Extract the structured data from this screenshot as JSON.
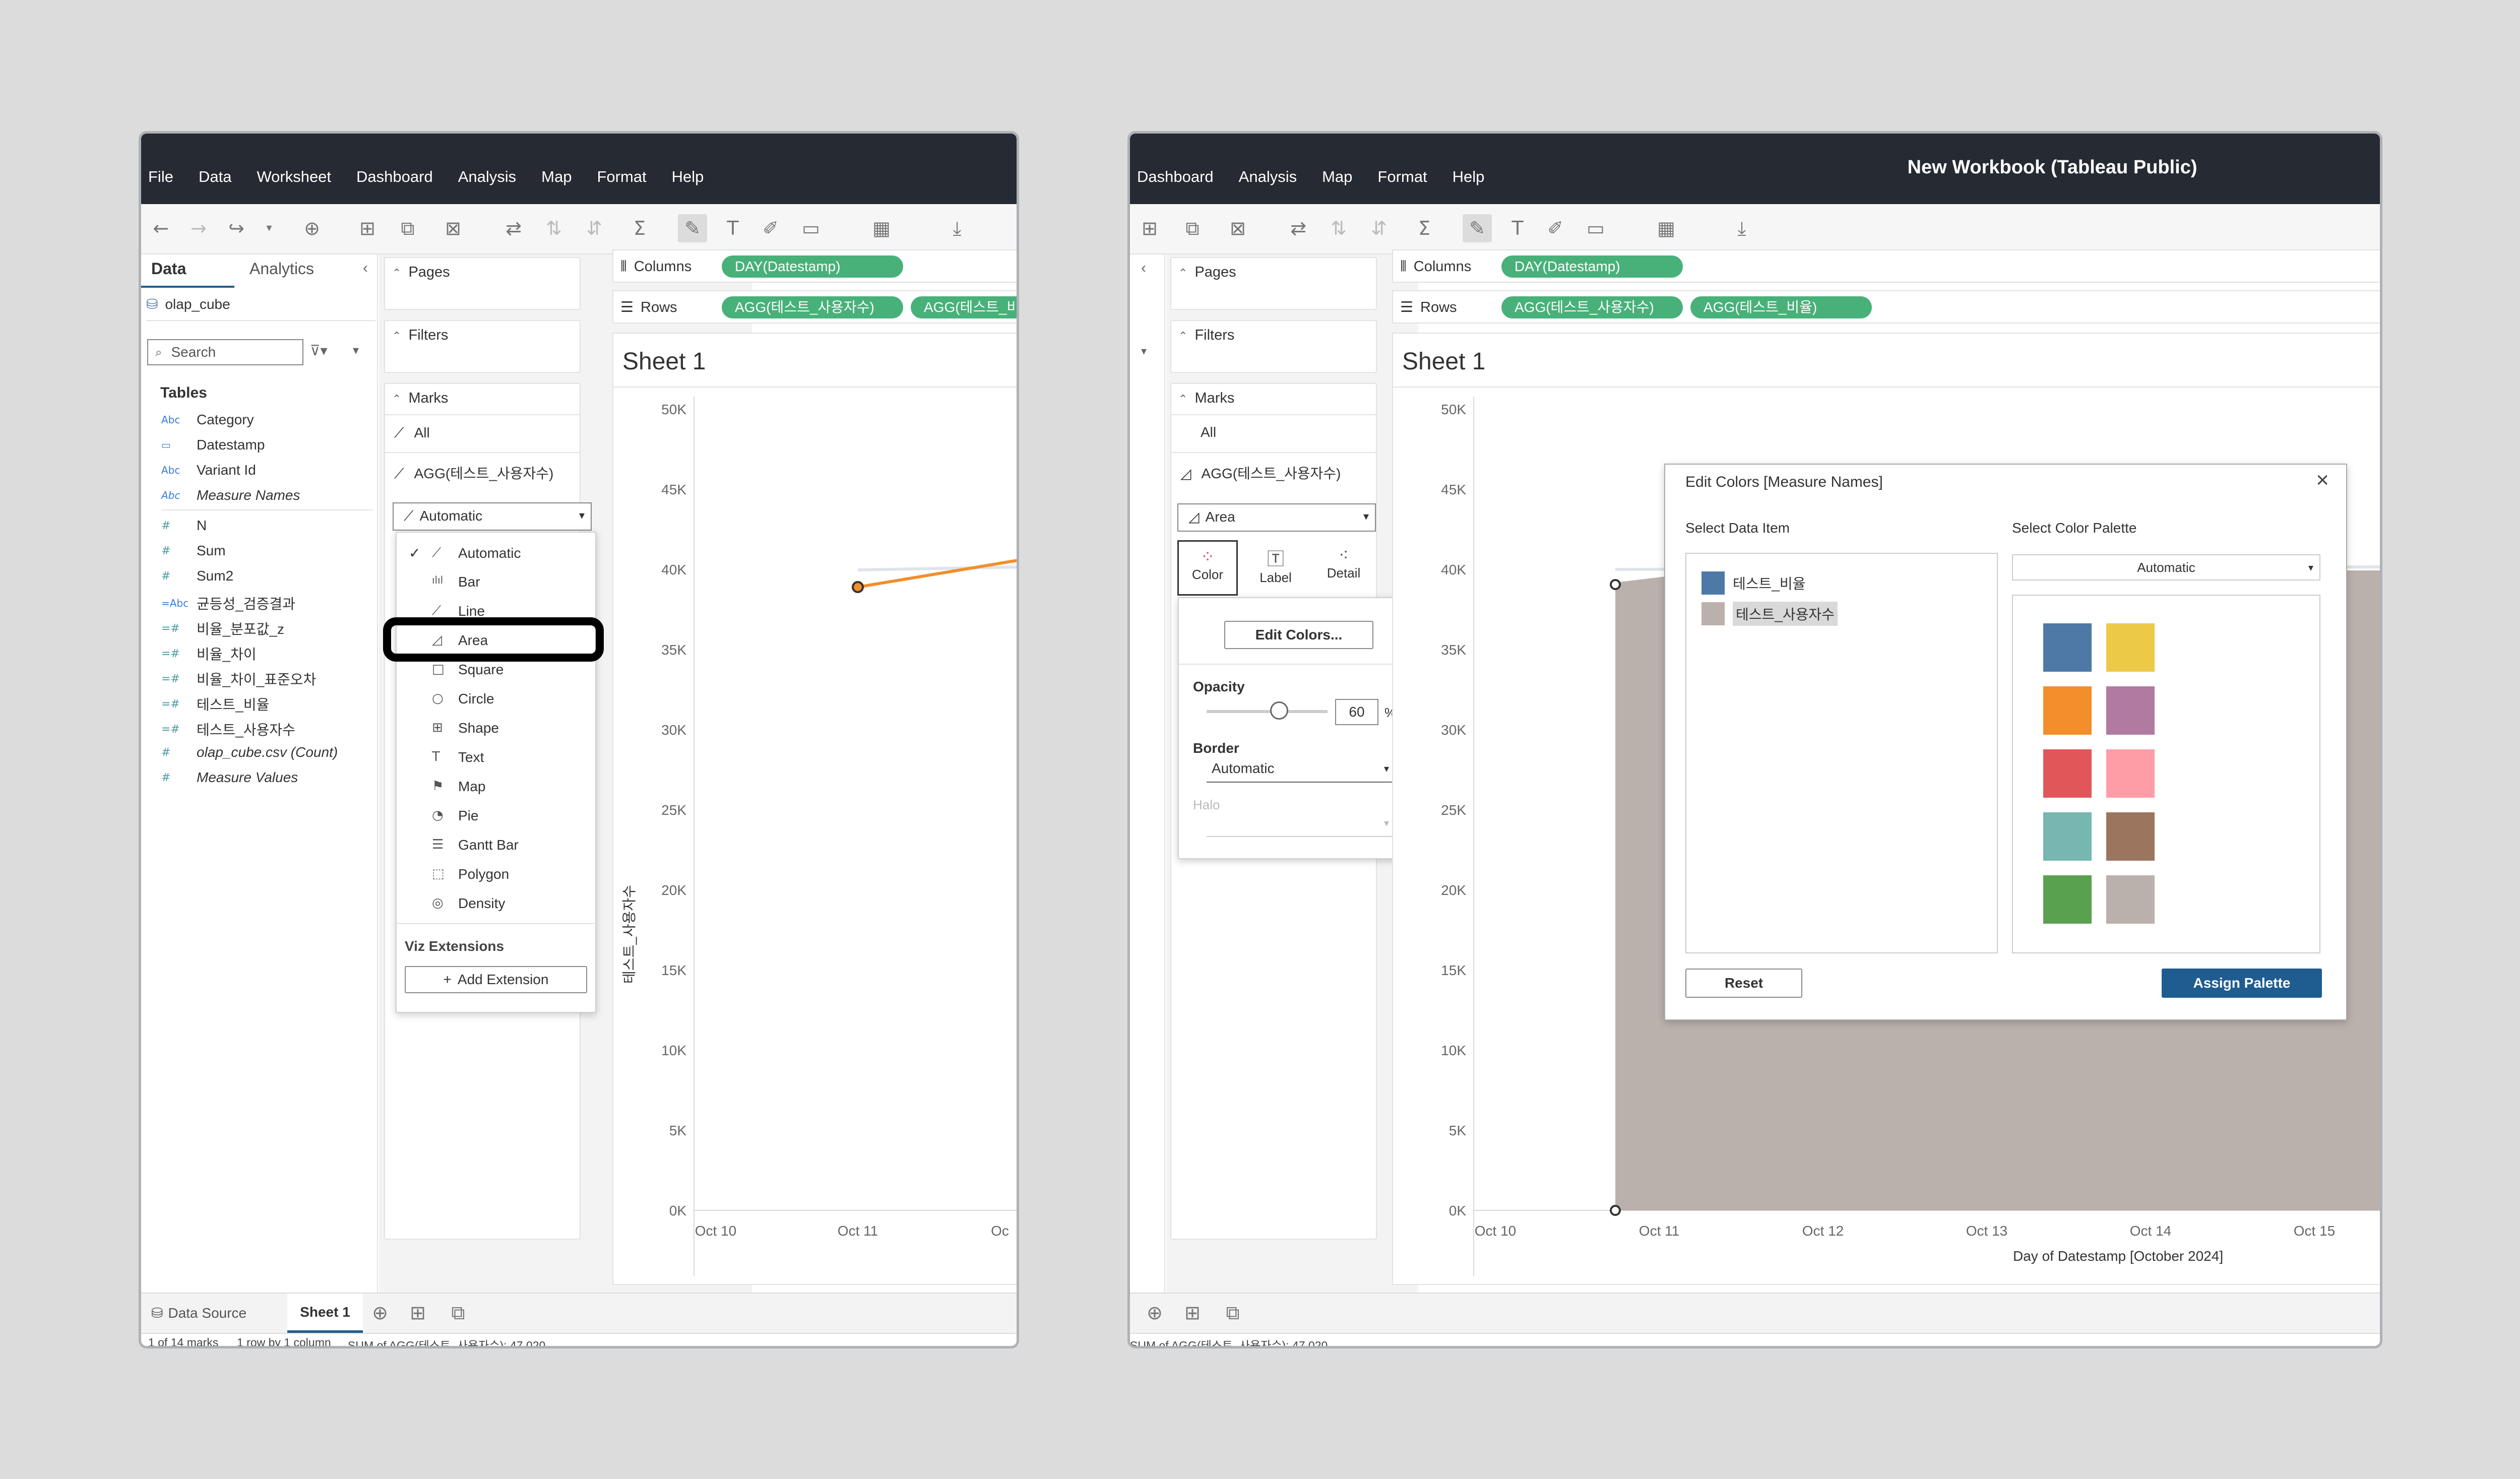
{
  "left": {
    "menu": [
      "File",
      "Data",
      "Worksheet",
      "Dashboard",
      "Analysis",
      "Map",
      "Format",
      "Help"
    ],
    "side_tabs": {
      "data": "Data",
      "analytics": "Analytics"
    },
    "datasource": "olap_cube",
    "search_placeholder": "Search",
    "tables_heading": "Tables",
    "fields": [
      {
        "icon": "Abc",
        "name": "Category"
      },
      {
        "icon": "▭",
        "name": "Datestamp"
      },
      {
        "icon": "Abc",
        "name": "Variant Id"
      },
      {
        "icon": "Abc",
        "name": "Measure Names"
      },
      {
        "icon": "#",
        "name": "N"
      },
      {
        "icon": "#",
        "name": "Sum"
      },
      {
        "icon": "#",
        "name": "Sum2"
      },
      {
        "icon": "=Abc",
        "name": "균등성_검증결과"
      },
      {
        "icon": "=#",
        "name": "비율_분포값_z"
      },
      {
        "icon": "=#",
        "name": "비율_차이"
      },
      {
        "icon": "=#",
        "name": "비율_차이_표준오차"
      },
      {
        "icon": "=#",
        "name": "테스트_비율"
      },
      {
        "icon": "=#",
        "name": "테스트_사용자수"
      },
      {
        "icon": "#",
        "name": "olap_cube.csv (Count)"
      },
      {
        "icon": "#",
        "name": "Measure Values"
      }
    ],
    "cards": {
      "pages": "Pages",
      "filters": "Filters",
      "marks": "Marks"
    },
    "marks_all": "All",
    "marks_measure": "AGG(테스트_사용자수)",
    "mark_type": "Automatic",
    "mark_menu": {
      "items": [
        {
          "icon": "⟋",
          "label": "Automatic",
          "checked": true
        },
        {
          "icon": "ılıl",
          "label": "Bar"
        },
        {
          "icon": "⟋",
          "label": "Line"
        },
        {
          "icon": "◿",
          "label": "Area"
        },
        {
          "icon": "□",
          "label": "Square"
        },
        {
          "icon": "○",
          "label": "Circle"
        },
        {
          "icon": "⊞",
          "label": "Shape"
        },
        {
          "icon": "T",
          "label": "Text"
        },
        {
          "icon": "⚑",
          "label": "Map"
        },
        {
          "icon": "◔",
          "label": "Pie"
        },
        {
          "icon": "☰",
          "label": "Gantt Bar"
        },
        {
          "icon": "⬚",
          "label": "Polygon"
        },
        {
          "icon": "◎",
          "label": "Density"
        }
      ],
      "extensions_heading": "Viz Extensions",
      "add_extension": "Add Extension"
    },
    "shelves": {
      "columns_label": "Columns",
      "rows_label": "Rows",
      "columns_pill": "DAY(Datestamp)",
      "rows_pills": [
        "AGG(테스트_사용자수)",
        "AGG(테스트_비율)"
      ]
    },
    "sheet_title": "Sheet 1",
    "y_axis_title": "테스트_사용자수",
    "y_ticks": [
      "50K",
      "45K",
      "40K",
      "35K",
      "30K",
      "25K",
      "20K",
      "15K",
      "10K",
      "5K",
      "0K"
    ],
    "x_ticks": [
      "Oct 10",
      "Oct 11",
      "Oc"
    ],
    "bottom_tabs": {
      "datasource": "Data Source",
      "sheet": "Sheet 1"
    },
    "status": {
      "marks": "1 of 14 marks",
      "rows": "1 row by 1 column",
      "sum": "SUM of AGG(테스트_사용자수): 47,020"
    }
  },
  "right": {
    "window_title": "New Workbook (Tableau Public)",
    "menu": [
      "Dashboard",
      "Analysis",
      "Map",
      "Format",
      "Help"
    ],
    "cards": {
      "pages": "Pages",
      "filters": "Filters",
      "marks": "Marks"
    },
    "marks_all": "All",
    "marks_measure": "AGG(테스트_사용자수)",
    "mark_type": "Area",
    "mark_buttons": {
      "color": "Color",
      "label": "Label",
      "detail": "Detail"
    },
    "color_popup": {
      "edit_colors": "Edit Colors...",
      "opacity_label": "Opacity",
      "opacity_value": "60",
      "opacity_unit": "%",
      "opacity_fraction": 0.6,
      "border_label": "Border",
      "border_value": "Automatic",
      "halo_label": "Halo"
    },
    "shelves": {
      "columns_label": "Columns",
      "rows_label": "Rows",
      "columns_pill": "DAY(Datestamp)",
      "rows_pills": [
        "AGG(테스트_사용자수)",
        "AGG(테스트_비율)"
      ]
    },
    "sheet_title": "Sheet 1",
    "y_ticks": [
      "50K",
      "45K",
      "40K",
      "35K",
      "30K",
      "25K",
      "20K",
      "15K",
      "10K",
      "5K",
      "0K"
    ],
    "x_ticks": [
      "Oct 10",
      "Oct 11",
      "Oct 12",
      "Oct 13",
      "Oct 14",
      "Oct 15"
    ],
    "x_axis_title": "Day of Datestamp [October 2024]",
    "dialog": {
      "title": "Edit Colors [Measure Names]",
      "select_data_item": "Select Data Item",
      "select_palette": "Select Color Palette",
      "palette_value": "Automatic",
      "items": [
        {
          "label": "테스트_비율",
          "color": "#4e79a7"
        },
        {
          "label": "테스트_사용자수",
          "color": "#bab0ac",
          "selected": true
        }
      ],
      "swatches": [
        "#4e79a7",
        "#edc948",
        "#f28e2b",
        "#b07aa1",
        "#e15759",
        "#ff9da7",
        "#76b7b2",
        "#9c755f",
        "#59a14f",
        "#bab0ac"
      ],
      "reset": "Reset",
      "assign": "Assign Palette"
    },
    "status": {
      "sum": "SUM of AGG(테스트_사용자수): 47,020"
    }
  },
  "colors": {
    "pill": "#48b17a",
    "line": "#f28e2b",
    "area": "#bab0ac",
    "assign": "#1f5c8f",
    "titlebar": "#262a33"
  }
}
